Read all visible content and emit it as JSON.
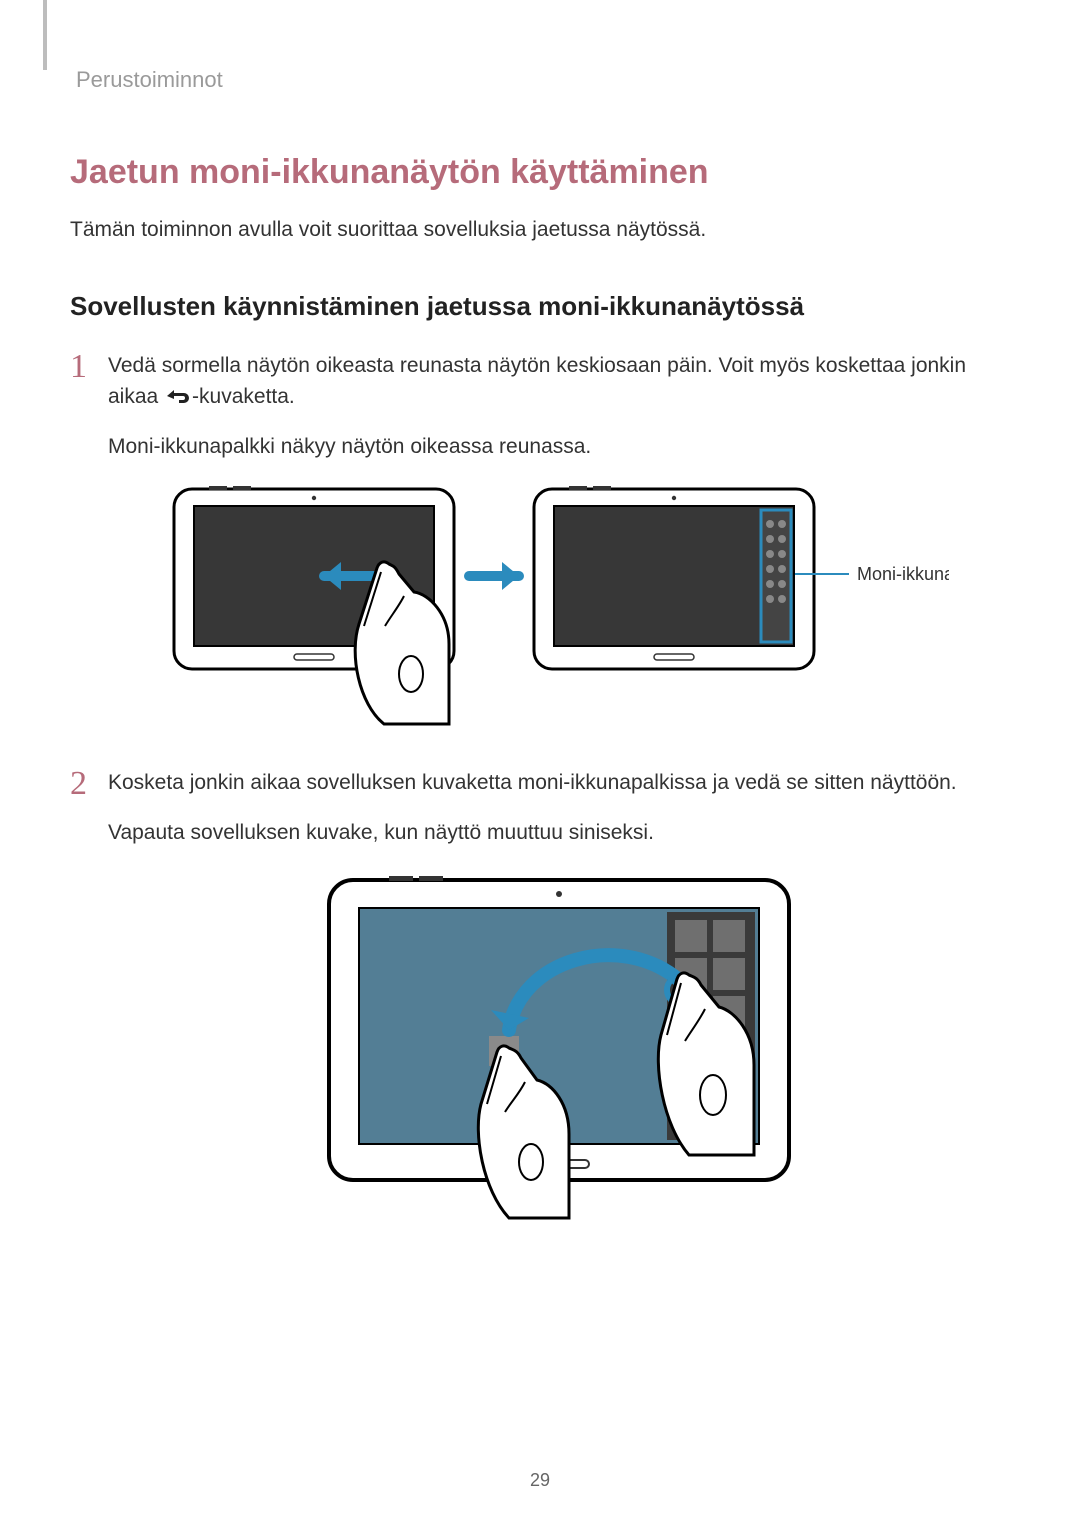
{
  "header": {
    "section_name": "Perustoiminnot"
  },
  "content": {
    "title": "Jaetun moni-ikkunanäytön käyttäminen",
    "intro": "Tämän toiminnon avulla voit suorittaa sovelluksia jaetussa näytössä.",
    "subheading": "Sovellusten käynnistäminen jaetussa moni-ikkunanäytössä",
    "steps": [
      {
        "num": "1",
        "text_part1": "Vedä sormella näytön oikeasta reunasta näytön keskiosaan päin. Voit myös koskettaa jonkin aikaa ",
        "text_part2": "-kuvaketta.",
        "after": "Moni-ikkunapalkki näkyy näytön oikeassa reunassa.",
        "callout": "Moni-ikkunapalkki"
      },
      {
        "num": "2",
        "text": "Kosketa jonkin aikaa sovelluksen kuvaketta moni-ikkunapalkissa ja vedä se sitten näyttöön.",
        "after": "Vapauta sovelluksen kuvake, kun näyttö muuttuu siniseksi."
      }
    ]
  },
  "footer": {
    "page_number": "29"
  }
}
